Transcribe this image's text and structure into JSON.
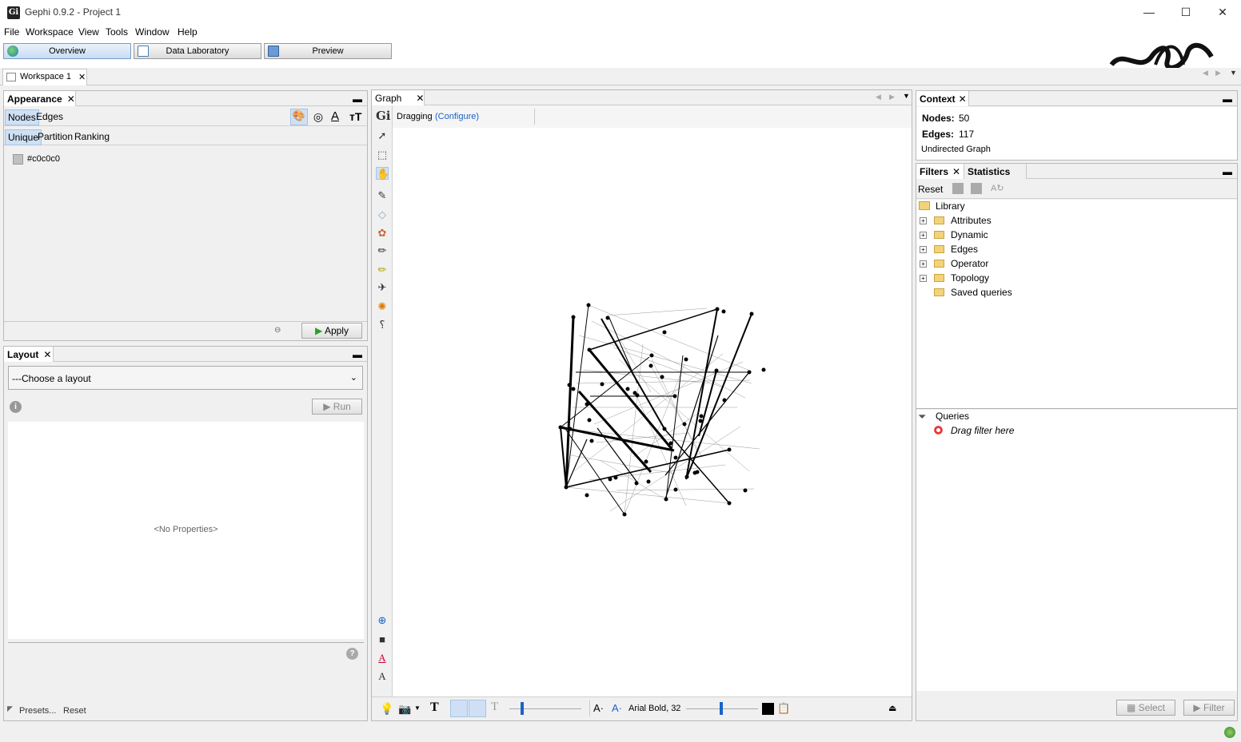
{
  "window": {
    "title": "Gephi 0.9.2 - Project 1",
    "logo": "Gi",
    "minimize": "—",
    "maximize": "☐",
    "close": "✕"
  },
  "menu": [
    "File",
    "Workspace",
    "View",
    "Tools",
    "Window",
    "Help"
  ],
  "perspectives": {
    "overview": "Overview",
    "data_lab": "Data Laboratory",
    "preview": "Preview"
  },
  "workspace_tab": {
    "label": "Workspace 1",
    "close": "✕"
  },
  "appearance": {
    "title": "Appearance",
    "tabs": {
      "nodes": "Nodes",
      "edges": "Edges"
    },
    "subtabs": {
      "unique": "Unique",
      "partition": "Partition",
      "ranking": "Ranking"
    },
    "color_value": "#c0c0c0",
    "apply": "Apply"
  },
  "layout": {
    "title": "Layout",
    "select": "---Choose a layout",
    "run": "Run",
    "no_props": "<No Properties>",
    "presets": "Presets...",
    "reset": "Reset"
  },
  "graph": {
    "tab": "Graph",
    "mode": "Dragging",
    "configure": "(Configure)",
    "font": "Arial Bold, 32"
  },
  "context": {
    "title": "Context",
    "nodes_label": "Nodes:",
    "nodes_value": "50",
    "edges_label": "Edges:",
    "edges_value": "117",
    "graph_type": "Undirected Graph"
  },
  "filters": {
    "tab_filters": "Filters",
    "tab_statistics": "Statistics",
    "reset": "Reset",
    "library": "Library",
    "tree": [
      "Attributes",
      "Dynamic",
      "Edges",
      "Operator",
      "Topology",
      "Saved queries"
    ],
    "queries": "Queries",
    "drag_hint": "Drag filter here",
    "select_btn": "Select",
    "filter_btn": "Filter"
  },
  "colors": {
    "selection": "#cfe0f5",
    "accent_blue": "#1a62c9"
  }
}
